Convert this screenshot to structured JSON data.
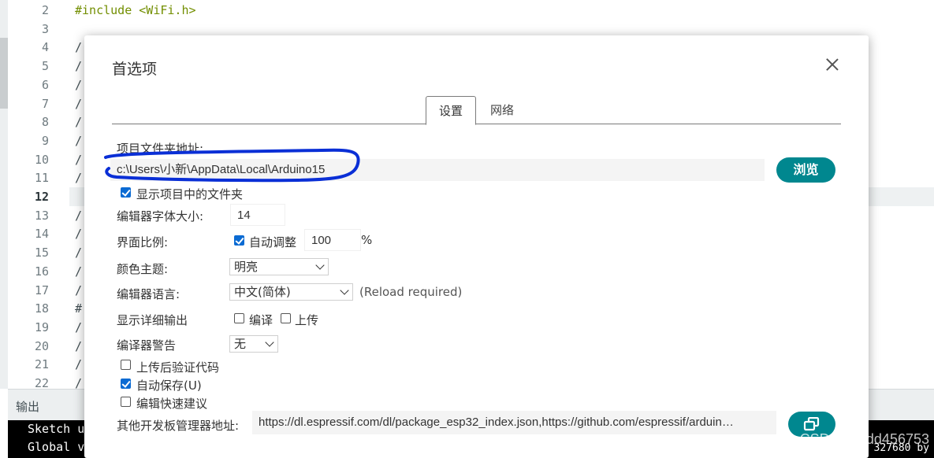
{
  "editor": {
    "line_numbers": [
      "2",
      "3",
      "4",
      "5",
      "6",
      "7",
      "8",
      "9",
      "10",
      "11",
      "12",
      "13",
      "14",
      "15",
      "16",
      "17",
      "18",
      "19",
      "20",
      "21",
      "22"
    ],
    "active_line": "12",
    "code_line_2": "#include <WiFi.h>",
    "slash": "/",
    "hash": "#"
  },
  "output": {
    "title": "输出",
    "console_line_1": "Sketch u",
    "console_line_2": "Global v",
    "console_right": "327680 by"
  },
  "watermark": "CSDN @ddd456753",
  "dialog": {
    "title": "首选项",
    "tabs": [
      {
        "label": "设置",
        "active": true
      },
      {
        "label": "网络",
        "active": false
      }
    ],
    "sketchbook_label": "项目文件夹地址:",
    "sketchbook_path": "c:\\Users\\小新\\AppData\\Local\\Arduino15",
    "browse_label": "浏览",
    "show_files_label": "显示项目中的文件夹",
    "show_files_checked": true,
    "font_size_label": "编辑器字体大小:",
    "font_size_value": "14",
    "scale_label": "界面比例:",
    "auto_scale_label": "自动调整",
    "auto_scale_checked": true,
    "scale_value": "100",
    "scale_unit": "%",
    "theme_label": "颜色主题:",
    "theme_value": "明亮",
    "language_label": "编辑器语言:",
    "language_value": "中文(简体)",
    "reload_note": "(Reload required)",
    "verbose_label": "显示详细输出",
    "verbose_compile_label": "编译",
    "verbose_compile_checked": false,
    "verbose_upload_label": "上传",
    "verbose_upload_checked": false,
    "warnings_label": "编译器警告",
    "warnings_value": "无",
    "verify_upload_label": "上传后验证代码",
    "verify_upload_checked": false,
    "autosave_label": "自动保存(U)",
    "autosave_checked": true,
    "quick_suggest_label": "编辑快速建议",
    "quick_suggest_checked": false,
    "board_urls_label": "其他开发板管理器地址:",
    "board_urls_value": "https://dl.espressif.com/dl/package_esp32_index.json,https://github.com/espressif/arduin…"
  },
  "colors": {
    "accent": "#00878f",
    "annotation": "#0a2fd6",
    "checkbox": "#0b6bd3"
  }
}
